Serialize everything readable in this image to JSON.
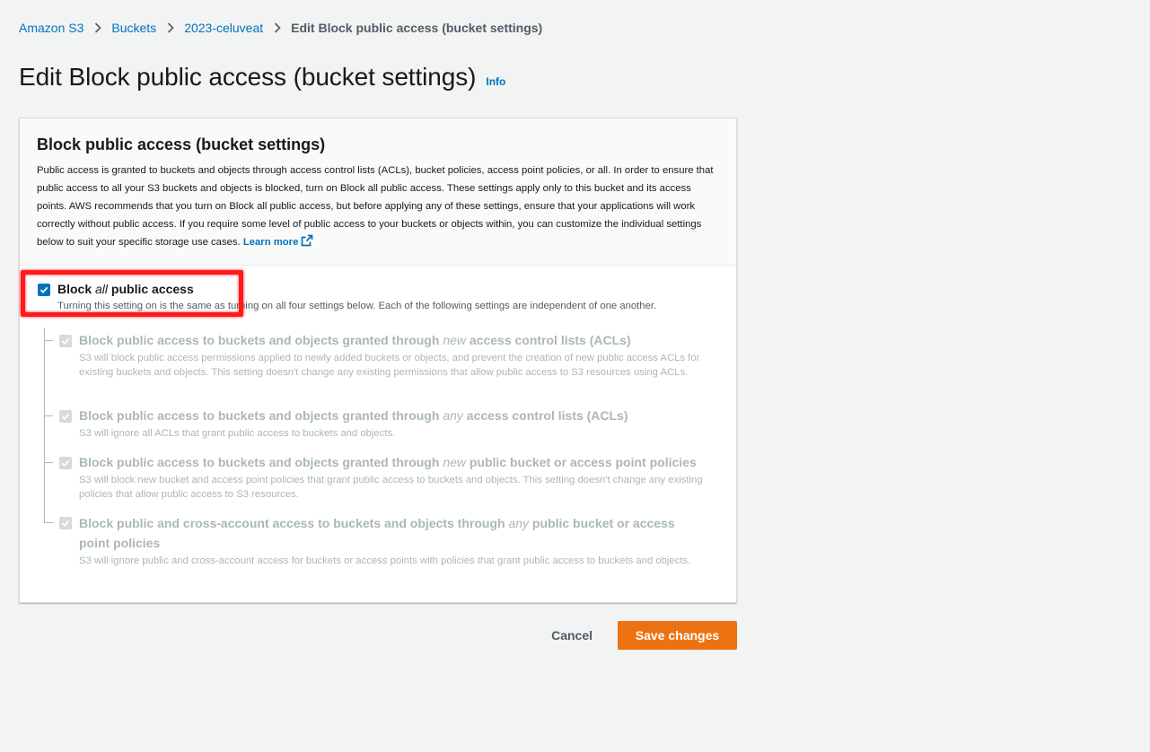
{
  "breadcrumb": {
    "items": [
      "Amazon S3",
      "Buckets",
      "2023-celuveat"
    ],
    "current": "Edit Block public access (bucket settings)"
  },
  "page": {
    "title": "Edit Block public access (bucket settings)",
    "info": "Info"
  },
  "panel": {
    "title": "Block public access (bucket settings)",
    "description": "Public access is granted to buckets and objects through access control lists (ACLs), bucket policies, access point policies, or all. In order to ensure that public access to all your S3 buckets and objects is blocked, turn on Block all public access. These settings apply only to this bucket and its access points. AWS recommends that you turn on Block all public access, but before applying any of these settings, ensure that your applications will work correctly without public access. If you require some level of public access to your buckets or objects within, you can customize the individual settings below to suit your specific storage use cases.",
    "learn_more": "Learn more"
  },
  "main_option": {
    "label_pre": "Block ",
    "label_em": "all",
    "label_post": " public access",
    "description": "Turning this setting on is the same as turning on all four settings below. Each of the following settings are independent of one another.",
    "checked": true
  },
  "sub_options": [
    {
      "label_pre": "Block public access to buckets and objects granted through ",
      "label_em": "new",
      "label_post": " access control lists (ACLs)",
      "description": "S3 will block public access permissions applied to newly added buckets or objects, and prevent the creation of new public access ACLs for existing buckets and objects. This setting doesn't change any existing permissions that allow public access to S3 resources using ACLs.",
      "checked": true
    },
    {
      "label_pre": "Block public access to buckets and objects granted through ",
      "label_em": "any",
      "label_post": " access control lists (ACLs)",
      "description": "S3 will ignore all ACLs that grant public access to buckets and objects.",
      "checked": true
    },
    {
      "label_pre": "Block public access to buckets and objects granted through ",
      "label_em": "new",
      "label_post": " public bucket or access point policies",
      "description": "S3 will block new bucket and access point policies that grant public access to buckets and objects. This setting doesn't change any existing policies that allow public access to S3 resources.",
      "checked": true
    },
    {
      "label_pre": "Block public and cross-account access to buckets and objects through ",
      "label_em": "any",
      "label_post": " public bucket or access point policies",
      "description": "S3 will ignore public and cross-account access for buckets or access points with policies that grant public access to buckets and objects.",
      "checked": true
    }
  ],
  "actions": {
    "cancel": "Cancel",
    "save": "Save changes"
  },
  "colors": {
    "link": "#0073bb",
    "primary_button": "#ec7211",
    "highlight": "#ff1a1a",
    "disabled_text": "#aab7b8"
  }
}
